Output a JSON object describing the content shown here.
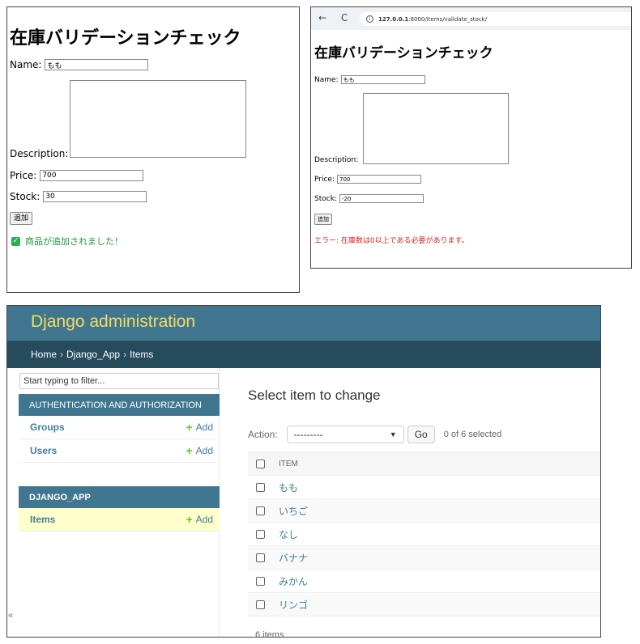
{
  "panel1": {
    "title": "在庫バリデーションチェック",
    "name_label": "Name:",
    "name_value": "もも",
    "description_label": "Description:",
    "description_value": "",
    "price_label": "Price:",
    "price_value": "700",
    "stock_label": "Stock:",
    "stock_value": "30",
    "submit_label": "追加",
    "success_message": "商品が追加されました！",
    "success_color": "#1a9a3a"
  },
  "panel2": {
    "browser": {
      "back_icon": "←",
      "reload_icon": "C",
      "info_icon": "i",
      "url_host": "127.0.0.1",
      "url_rest": ":8000/items/validate_stock/"
    },
    "title": "在庫バリデーションチェック",
    "name_label": "Name:",
    "name_value": "もも",
    "description_label": "Description:",
    "description_value": "",
    "price_label": "Price:",
    "price_value": "700",
    "stock_label": "Stock:",
    "stock_value": "-20",
    "submit_label": "追加",
    "error_message": "エラー: 在庫数は0以上である必要があります。",
    "error_color": "#e02020"
  },
  "admin": {
    "brand": "Django administration",
    "breadcrumbs": [
      "Home",
      "Django_App",
      "Items"
    ],
    "breadcrumb_sep": "›",
    "sidebar": {
      "filter_placeholder": "Start typing to filter...",
      "modules": [
        {
          "header": "AUTHENTICATION AND AUTHORIZATION",
          "rows": [
            {
              "name": "Groups",
              "add": "Add"
            },
            {
              "name": "Users",
              "add": "Add"
            }
          ]
        },
        {
          "header": "DJANGO_APP",
          "rows": [
            {
              "name": "Items",
              "add": "Add"
            }
          ]
        }
      ],
      "collapse_icon": "«"
    },
    "main": {
      "title": "Select item to change",
      "action_label": "Action:",
      "action_value": "---------",
      "go_label": "Go",
      "selected_counter": "0 of 6 selected",
      "column_header": "ITEM",
      "items": [
        "もも",
        "いちご",
        "なし",
        "バナナ",
        "みかん",
        "リンゴ"
      ],
      "paginator": "6 items"
    },
    "colors": {
      "header": "#417690",
      "breadcrumbs": "#264b5d",
      "brand": "#f5dd5d",
      "link": "#447e9b",
      "add_plus": "#70bf2b",
      "current_row": "#ffffcc"
    }
  }
}
